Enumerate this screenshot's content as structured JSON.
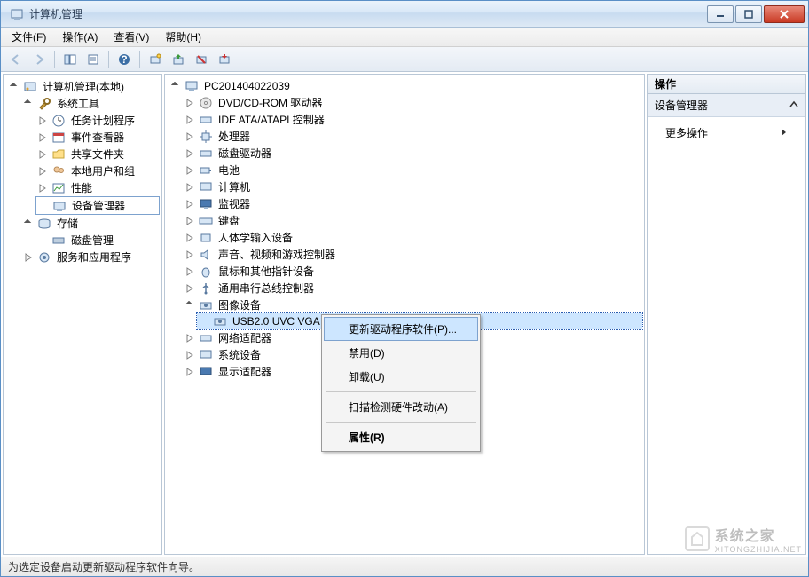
{
  "window": {
    "title": "计算机管理"
  },
  "menu": {
    "file": "文件(F)",
    "action": "操作(A)",
    "view": "查看(V)",
    "help": "帮助(H)"
  },
  "left_tree": {
    "root": "计算机管理(本地)",
    "system_tools": "系统工具",
    "task_scheduler": "任务计划程序",
    "event_viewer": "事件查看器",
    "shared_folders": "共享文件夹",
    "local_users": "本地用户和组",
    "performance": "性能",
    "device_manager": "设备管理器",
    "storage": "存储",
    "disk_management": "磁盘管理",
    "services_apps": "服务和应用程序"
  },
  "center_tree": {
    "computer": "PC201404022039",
    "dvd": "DVD/CD-ROM 驱动器",
    "ide": "IDE ATA/ATAPI 控制器",
    "cpu": "处理器",
    "disk": "磁盘驱动器",
    "battery": "电池",
    "computers": "计算机",
    "monitor": "监视器",
    "keyboard": "键盘",
    "hid": "人体学输入设备",
    "sound": "声音、视频和游戏控制器",
    "mouse": "鼠标和其他指针设备",
    "usb": "通用串行总线控制器",
    "imaging": "图像设备",
    "webcam": "USB2.0 UVC VGA WebCam",
    "network": "网络适配器",
    "system_dev": "系统设备",
    "display": "显示适配器"
  },
  "context_menu": {
    "update_driver": "更新驱动程序软件(P)...",
    "disable": "禁用(D)",
    "uninstall": "卸载(U)",
    "scan_hardware": "扫描检测硬件改动(A)",
    "properties": "属性(R)"
  },
  "actions": {
    "header": "操作",
    "sub_header": "设备管理器",
    "more_actions": "更多操作"
  },
  "statusbar": {
    "text": "为选定设备启动更新驱动程序软件向导。"
  },
  "watermark": {
    "name": "系统之家",
    "url": "XITONGZHIJIA.NET"
  }
}
